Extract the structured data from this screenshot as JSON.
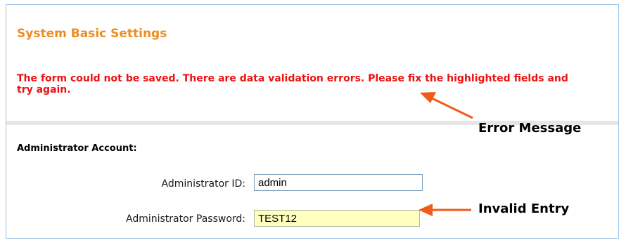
{
  "page": {
    "title": "System Basic Settings",
    "error_message": "The form could not be saved. There are data validation errors. Please fix the highlighted fields and try again."
  },
  "admin_section": {
    "heading": "Administrator Account:",
    "fields": [
      {
        "label": "Administrator ID:",
        "value": "admin",
        "state": "valid"
      },
      {
        "label": "Administrator Password:",
        "value": "TEST12",
        "state": "invalid"
      }
    ]
  },
  "annotations": {
    "error_message_callout": "Error Message",
    "invalid_entry_callout": "Invalid Entry",
    "arrow_color": "#f05a1a"
  },
  "colors": {
    "title": "#f08c1e",
    "error_text": "#ee1111",
    "invalid_field_background": "#ffffc0",
    "panel_border": "#9fc4e6"
  }
}
